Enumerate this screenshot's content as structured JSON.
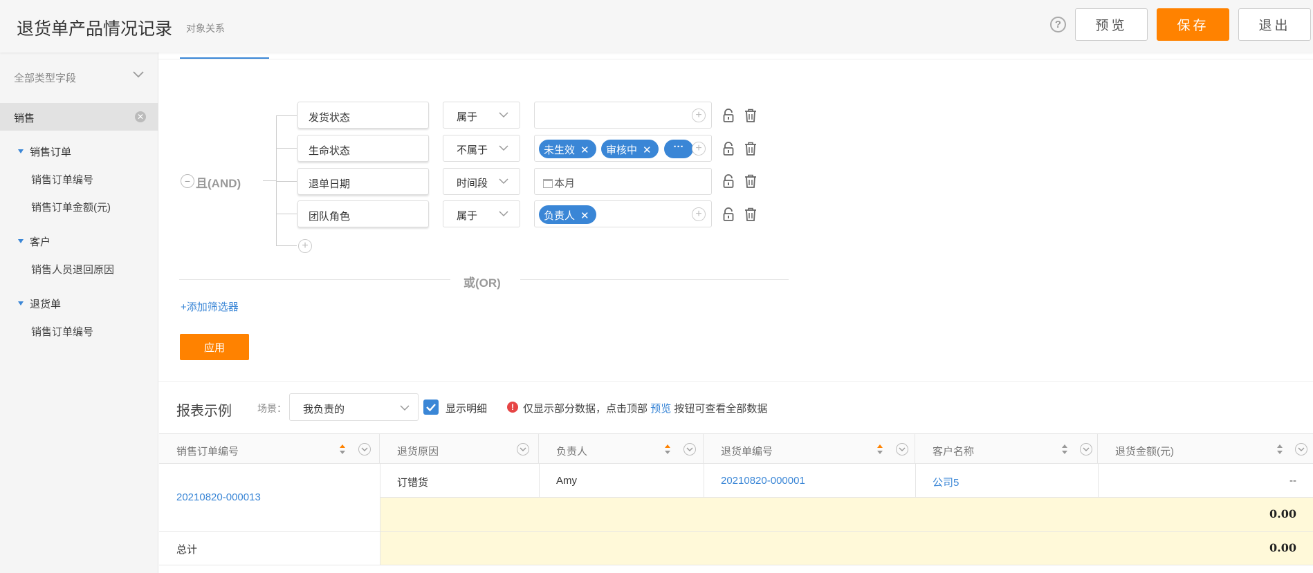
{
  "header": {
    "title": "退货单产品情况记录",
    "subtitle": "对象关系",
    "help_icon": "?",
    "preview_label": "预览",
    "save_label": "保存",
    "exit_label": "退出"
  },
  "sidebar": {
    "filter_label": "全部类型字段",
    "active_tag": "销售",
    "groups": [
      {
        "label": "销售订单",
        "items": [
          "销售订单编号",
          "销售订单金额(元)"
        ]
      },
      {
        "label": "客户",
        "items": [
          "销售人员退回原因"
        ]
      },
      {
        "label": "退货单",
        "items": [
          "销售订单编号"
        ]
      }
    ]
  },
  "filter": {
    "and_label": "且(AND)",
    "and_toggle": "−",
    "conditions": [
      {
        "field": "发货状态",
        "operator": "属于",
        "chips": []
      },
      {
        "field": "生命状态",
        "operator": "不属于",
        "chips": [
          "未生效",
          "审核中"
        ],
        "more": "···"
      },
      {
        "field": "退单日期",
        "operator": "时间段",
        "date_value": "本月"
      },
      {
        "field": "团队角色",
        "operator": "属于",
        "chips": [
          "负责人"
        ]
      }
    ],
    "chip_remove": "✕",
    "plus": "+",
    "or_label": "或(OR)",
    "add_filter_label": "+添加筛选器",
    "apply_label": "应用"
  },
  "report": {
    "title": "报表示例",
    "scene_label": "场景：",
    "scene_value": "我负责的",
    "show_detail_label": "显示明细",
    "show_detail_checked": true,
    "warning_icon": "!",
    "notice_prefix": "仅显示部分数据，点击顶部",
    "notice_link": "预览",
    "notice_suffix": "按钮可查看全部数据",
    "columns": [
      "销售订单编号",
      "退货原因",
      "负责人",
      "退货单编号",
      "客户名称",
      "退货金额(元)"
    ],
    "row": {
      "order_no": "20210820-000013",
      "reason": "订错货",
      "owner": "Amy",
      "return_no": "20210820-000001",
      "customer": "公司5",
      "amount": "--"
    },
    "subtotal": "0.00",
    "total_label": "总计",
    "total": "0.00"
  },
  "colors": {
    "accent_orange": "#ff8200",
    "accent_blue": "#3a86d6",
    "highlight_yellow": "#fff9d9",
    "sort_active": "#ff8200"
  }
}
